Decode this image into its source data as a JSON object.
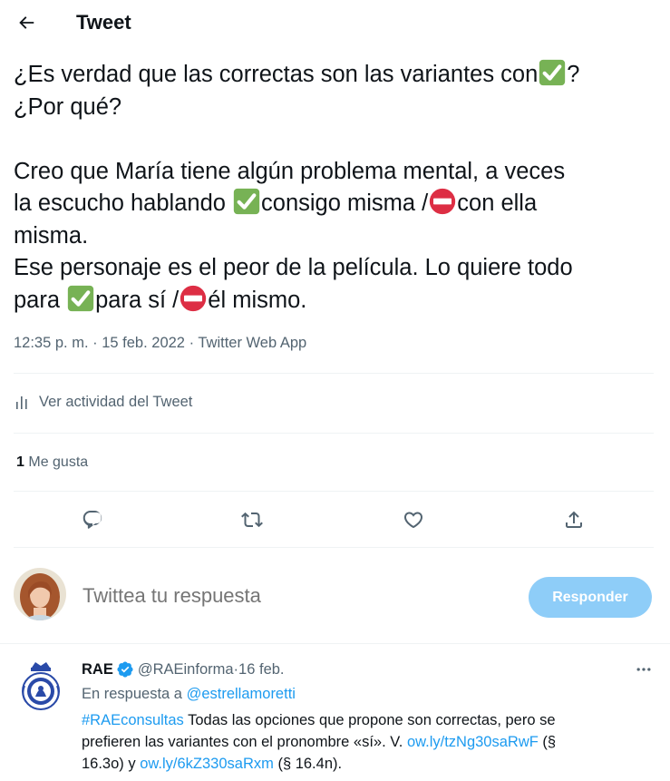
{
  "header": {
    "title": "Tweet"
  },
  "tweet": {
    "lines": [
      [
        "¿Es verdad que las correctas son las variantes con",
        "?"
      ],
      [
        "¿Por qué?"
      ],
      [
        ""
      ],
      [
        "Creo que María tiene algún problema mental, a veces"
      ],
      [
        "la escucho hablando ",
        "consigo misma /",
        "con ella"
      ],
      [
        "misma."
      ],
      [
        "Ese personaje es el peor de la película. Lo quiere todo"
      ],
      [
        "para ",
        "para sí /",
        "él mismo."
      ]
    ],
    "emoji_names": {
      "check": "check-mark-button",
      "no_entry": "no-entry"
    },
    "time": "12:35 p. m.",
    "separator": " · ",
    "date": "15 feb. 2022",
    "source": "Twitter Web App"
  },
  "activity": {
    "label": "Ver actividad del Tweet"
  },
  "stats": {
    "likes_count": "1",
    "likes_label": "Me gusta"
  },
  "actions": {
    "icons": [
      "reply-icon",
      "retweet-icon",
      "like-icon",
      "share-icon"
    ]
  },
  "compose": {
    "placeholder": "Twittea tu respuesta",
    "button_label": "Responder"
  },
  "reply": {
    "name": "RAE",
    "handle": "@RAEinforma",
    "dot": " · ",
    "date": "16 feb.",
    "reply_prefix": "En respuesta a ",
    "reply_to": "@estrellamoretti",
    "hashtag": "#RAEconsultas",
    "body_1": " Todas las opciones que propone son correctas, pero se",
    "body_2": "prefieren las variantes con el pronombre «sí». V. ",
    "link_1": "ow.ly/tzNg30saRwF",
    "body_3": " (§",
    "body_4": "16.3o) y ",
    "link_2": "ow.ly/6kZ330saRxm",
    "body_5": " (§ 16.4n)."
  },
  "colors": {
    "accent": "#1d9bf0",
    "button_disabled": "#8ecdf8",
    "secondary_text": "#536471",
    "check_green": "#77b255",
    "no_entry_red": "#dd2e44"
  }
}
